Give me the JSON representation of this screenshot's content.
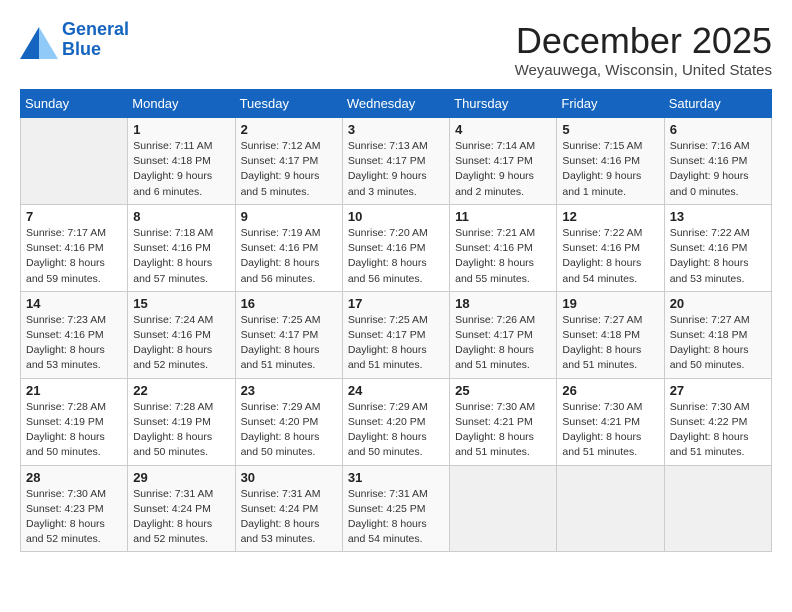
{
  "logo": {
    "line1": "General",
    "line2": "Blue"
  },
  "title": "December 2025",
  "location": "Weyauwega, Wisconsin, United States",
  "days_of_week": [
    "Sunday",
    "Monday",
    "Tuesday",
    "Wednesday",
    "Thursday",
    "Friday",
    "Saturday"
  ],
  "weeks": [
    [
      {
        "day": "",
        "info": ""
      },
      {
        "day": "1",
        "info": "Sunrise: 7:11 AM\nSunset: 4:18 PM\nDaylight: 9 hours\nand 6 minutes."
      },
      {
        "day": "2",
        "info": "Sunrise: 7:12 AM\nSunset: 4:17 PM\nDaylight: 9 hours\nand 5 minutes."
      },
      {
        "day": "3",
        "info": "Sunrise: 7:13 AM\nSunset: 4:17 PM\nDaylight: 9 hours\nand 3 minutes."
      },
      {
        "day": "4",
        "info": "Sunrise: 7:14 AM\nSunset: 4:17 PM\nDaylight: 9 hours\nand 2 minutes."
      },
      {
        "day": "5",
        "info": "Sunrise: 7:15 AM\nSunset: 4:16 PM\nDaylight: 9 hours\nand 1 minute."
      },
      {
        "day": "6",
        "info": "Sunrise: 7:16 AM\nSunset: 4:16 PM\nDaylight: 9 hours\nand 0 minutes."
      }
    ],
    [
      {
        "day": "7",
        "info": "Sunrise: 7:17 AM\nSunset: 4:16 PM\nDaylight: 8 hours\nand 59 minutes."
      },
      {
        "day": "8",
        "info": "Sunrise: 7:18 AM\nSunset: 4:16 PM\nDaylight: 8 hours\nand 57 minutes."
      },
      {
        "day": "9",
        "info": "Sunrise: 7:19 AM\nSunset: 4:16 PM\nDaylight: 8 hours\nand 56 minutes."
      },
      {
        "day": "10",
        "info": "Sunrise: 7:20 AM\nSunset: 4:16 PM\nDaylight: 8 hours\nand 56 minutes."
      },
      {
        "day": "11",
        "info": "Sunrise: 7:21 AM\nSunset: 4:16 PM\nDaylight: 8 hours\nand 55 minutes."
      },
      {
        "day": "12",
        "info": "Sunrise: 7:22 AM\nSunset: 4:16 PM\nDaylight: 8 hours\nand 54 minutes."
      },
      {
        "day": "13",
        "info": "Sunrise: 7:22 AM\nSunset: 4:16 PM\nDaylight: 8 hours\nand 53 minutes."
      }
    ],
    [
      {
        "day": "14",
        "info": "Sunrise: 7:23 AM\nSunset: 4:16 PM\nDaylight: 8 hours\nand 53 minutes."
      },
      {
        "day": "15",
        "info": "Sunrise: 7:24 AM\nSunset: 4:16 PM\nDaylight: 8 hours\nand 52 minutes."
      },
      {
        "day": "16",
        "info": "Sunrise: 7:25 AM\nSunset: 4:17 PM\nDaylight: 8 hours\nand 51 minutes."
      },
      {
        "day": "17",
        "info": "Sunrise: 7:25 AM\nSunset: 4:17 PM\nDaylight: 8 hours\nand 51 minutes."
      },
      {
        "day": "18",
        "info": "Sunrise: 7:26 AM\nSunset: 4:17 PM\nDaylight: 8 hours\nand 51 minutes."
      },
      {
        "day": "19",
        "info": "Sunrise: 7:27 AM\nSunset: 4:18 PM\nDaylight: 8 hours\nand 51 minutes."
      },
      {
        "day": "20",
        "info": "Sunrise: 7:27 AM\nSunset: 4:18 PM\nDaylight: 8 hours\nand 50 minutes."
      }
    ],
    [
      {
        "day": "21",
        "info": "Sunrise: 7:28 AM\nSunset: 4:19 PM\nDaylight: 8 hours\nand 50 minutes."
      },
      {
        "day": "22",
        "info": "Sunrise: 7:28 AM\nSunset: 4:19 PM\nDaylight: 8 hours\nand 50 minutes."
      },
      {
        "day": "23",
        "info": "Sunrise: 7:29 AM\nSunset: 4:20 PM\nDaylight: 8 hours\nand 50 minutes."
      },
      {
        "day": "24",
        "info": "Sunrise: 7:29 AM\nSunset: 4:20 PM\nDaylight: 8 hours\nand 50 minutes."
      },
      {
        "day": "25",
        "info": "Sunrise: 7:30 AM\nSunset: 4:21 PM\nDaylight: 8 hours\nand 51 minutes."
      },
      {
        "day": "26",
        "info": "Sunrise: 7:30 AM\nSunset: 4:21 PM\nDaylight: 8 hours\nand 51 minutes."
      },
      {
        "day": "27",
        "info": "Sunrise: 7:30 AM\nSunset: 4:22 PM\nDaylight: 8 hours\nand 51 minutes."
      }
    ],
    [
      {
        "day": "28",
        "info": "Sunrise: 7:30 AM\nSunset: 4:23 PM\nDaylight: 8 hours\nand 52 minutes."
      },
      {
        "day": "29",
        "info": "Sunrise: 7:31 AM\nSunset: 4:24 PM\nDaylight: 8 hours\nand 52 minutes."
      },
      {
        "day": "30",
        "info": "Sunrise: 7:31 AM\nSunset: 4:24 PM\nDaylight: 8 hours\nand 53 minutes."
      },
      {
        "day": "31",
        "info": "Sunrise: 7:31 AM\nSunset: 4:25 PM\nDaylight: 8 hours\nand 54 minutes."
      },
      {
        "day": "",
        "info": ""
      },
      {
        "day": "",
        "info": ""
      },
      {
        "day": "",
        "info": ""
      }
    ]
  ]
}
